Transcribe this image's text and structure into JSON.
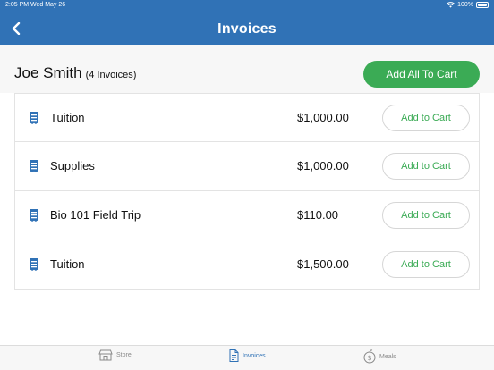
{
  "status_bar": {
    "time": "2:05 PM",
    "date": "Wed May 26",
    "battery": "100%"
  },
  "nav": {
    "title": "Invoices",
    "back_icon": "chevron-left-icon"
  },
  "summary": {
    "customer": "Joe Smith",
    "invoice_count": "(4 Invoices)",
    "add_all_label": "Add All To Cart"
  },
  "invoices": [
    {
      "title": "Tuition",
      "amount": "$1,000.00",
      "button": "Add to Cart"
    },
    {
      "title": "Supplies",
      "amount": "$1,000.00",
      "button": "Add to Cart"
    },
    {
      "title": "Bio 101 Field Trip",
      "amount": "$110.00",
      "button": "Add to Cart"
    },
    {
      "title": "Tuition",
      "amount": "$1,500.00",
      "button": "Add to Cart"
    }
  ],
  "tabs": [
    {
      "label": "Store",
      "icon": "store-icon"
    },
    {
      "label": "Invoices",
      "icon": "invoice-icon",
      "active": true
    },
    {
      "label": "Meals",
      "icon": "meals-icon"
    }
  ],
  "colors": {
    "header": "#3072b6",
    "accent_green": "#3bab55",
    "active_tab": "#3072b6"
  }
}
